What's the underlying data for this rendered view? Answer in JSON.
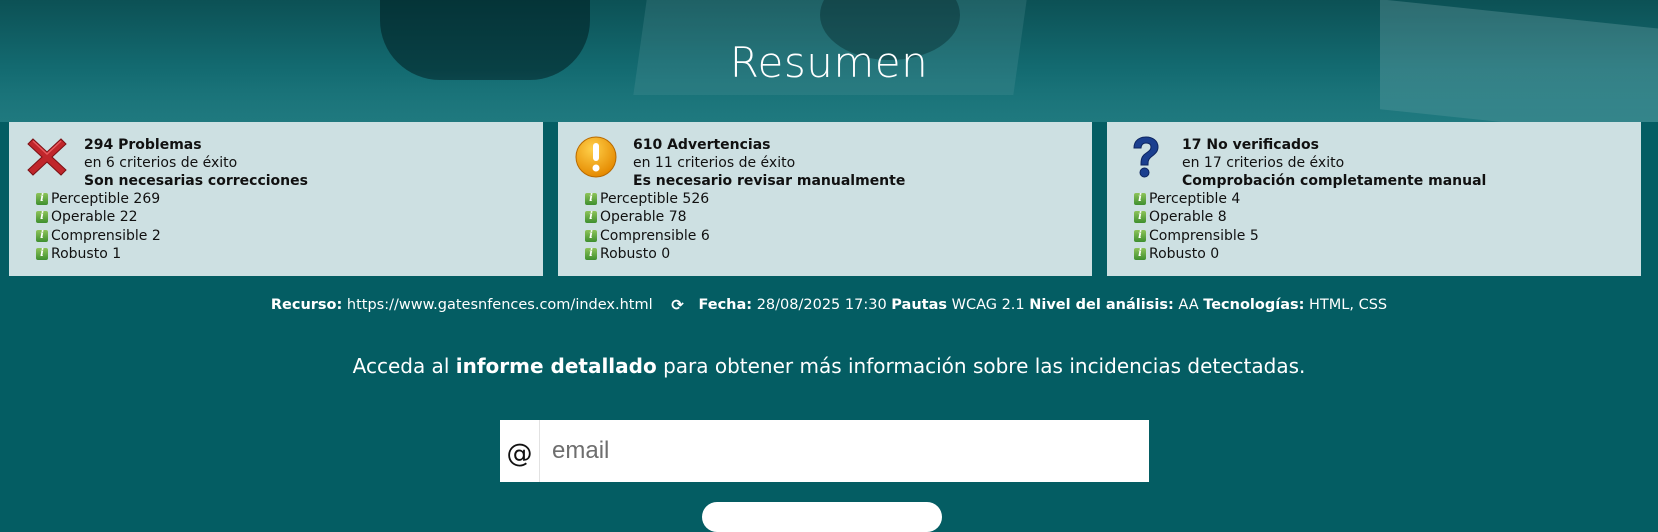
{
  "title": "Resumen",
  "cards": [
    {
      "icon": "error-x-icon",
      "count_text": "294 Problemas",
      "criteria_text": "en 6 criterios de éxito",
      "message": "Son necesarias correcciones",
      "items": [
        {
          "label": "Perceptible 269"
        },
        {
          "label": "Operable 22"
        },
        {
          "label": "Comprensible 2"
        },
        {
          "label": "Robusto 1"
        }
      ]
    },
    {
      "icon": "warning-exclamation-icon",
      "count_text": "610 Advertencias",
      "criteria_text": "en 11 criterios de éxito",
      "message": "Es necesario revisar manualmente",
      "items": [
        {
          "label": "Perceptible 526"
        },
        {
          "label": "Operable 78"
        },
        {
          "label": "Comprensible 6"
        },
        {
          "label": "Robusto 0"
        }
      ]
    },
    {
      "icon": "question-mark-icon",
      "count_text": "17 No verificados",
      "criteria_text": "en 17 criterios de éxito",
      "message": "Comprobación completamente manual",
      "items": [
        {
          "label": "Perceptible 4"
        },
        {
          "label": "Operable 8"
        },
        {
          "label": "Comprensible 5"
        },
        {
          "label": "Robusto 0"
        }
      ]
    }
  ],
  "meta": {
    "resource_label": "Recurso:",
    "resource_value": "https://www.gatesnfences.com/index.html",
    "date_label": "Fecha:",
    "date_value": "28/08/2025 17:30",
    "guidelines_label": "Pautas",
    "guidelines_value": "WCAG 2.1",
    "level_label": "Nivel del análisis:",
    "level_value": "AA",
    "tech_label": "Tecnologías:",
    "tech_value": "HTML, CSS"
  },
  "cta": {
    "prefix": "Acceda al",
    "bold": "informe detallado",
    "suffix": "para obtener más información sobre las incidencias detectadas."
  },
  "email": {
    "addon": "@",
    "placeholder": "email",
    "value": ""
  },
  "colors": {
    "background": "#045d63",
    "card": "#cde0e2",
    "error": "#c0262b",
    "warning": "#f2a100",
    "question": "#1b3f8f",
    "info": "#5ba33b"
  }
}
